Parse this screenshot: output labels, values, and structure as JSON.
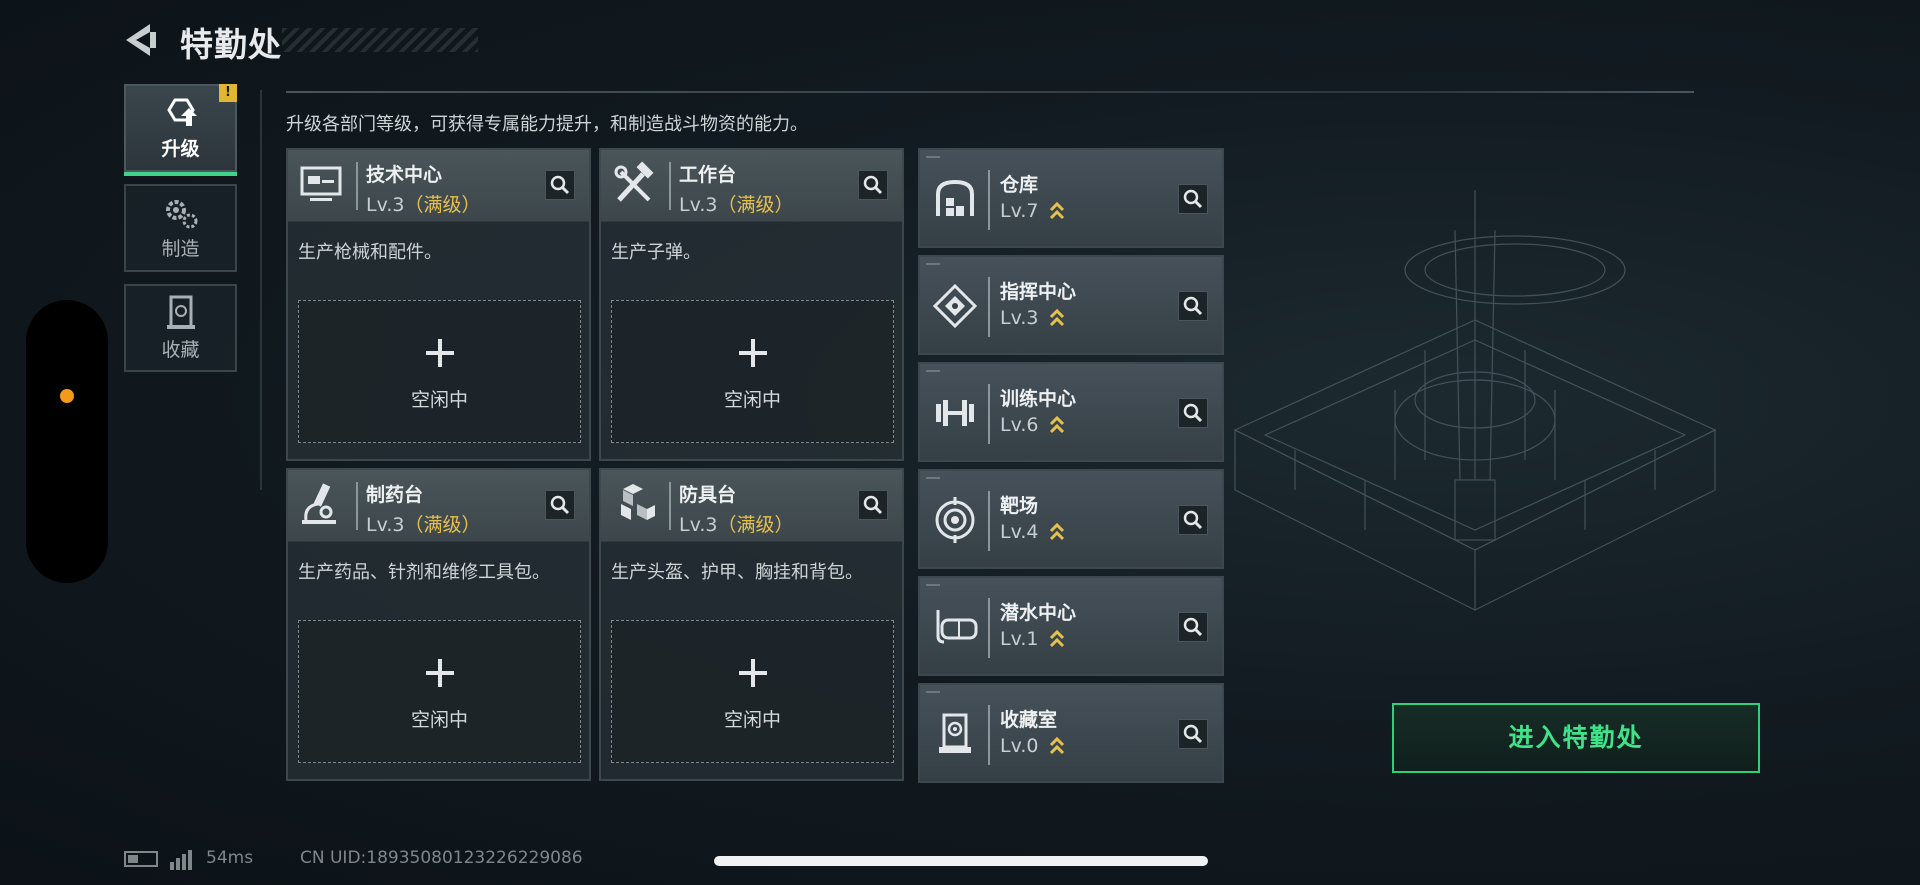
{
  "header": {
    "title": "特勤处"
  },
  "menu": {
    "items": [
      {
        "label": "升级",
        "icon": "upgrade-icon",
        "active": true,
        "alert": "!"
      },
      {
        "label": "制造",
        "icon": "gears-icon",
        "active": false
      },
      {
        "label": "收藏",
        "icon": "collection-icon",
        "active": false
      }
    ]
  },
  "description": "升级各部门等级，可获得专属能力提升，和制造战斗物资的能力。",
  "production_stations": [
    {
      "name": "技术中心",
      "level": "Lv.3",
      "max_tag": "（满级）",
      "desc": "生产枪械和配件。",
      "slot_status": "空闲中",
      "icon": "monitor-icon"
    },
    {
      "name": "工作台",
      "level": "Lv.3",
      "max_tag": "（满级）",
      "desc": "生产子弹。",
      "slot_status": "空闲中",
      "icon": "tools-icon"
    },
    {
      "name": "制药台",
      "level": "Lv.3",
      "max_tag": "（满级）",
      "desc": "生产药品、针剂和维修工具包。",
      "slot_status": "空闲中",
      "icon": "microscope-icon"
    },
    {
      "name": "防具台",
      "level": "Lv.3",
      "max_tag": "（满级）",
      "desc": "生产头盔、护甲、胸挂和背包。",
      "slot_status": "空闲中",
      "icon": "armor-blocks-icon"
    }
  ],
  "departments": [
    {
      "name": "仓库",
      "level": "Lv.7",
      "icon": "warehouse-icon"
    },
    {
      "name": "指挥中心",
      "level": "Lv.3",
      "icon": "command-chip-icon"
    },
    {
      "name": "训练中心",
      "level": "Lv.6",
      "icon": "dumbbell-icon"
    },
    {
      "name": "靶场",
      "level": "Lv.4",
      "icon": "target-icon"
    },
    {
      "name": "潜水中心",
      "level": "Lv.1",
      "icon": "diving-mask-icon"
    },
    {
      "name": "收藏室",
      "level": "Lv.0",
      "icon": "collection-room-icon"
    }
  ],
  "enter_button": "进入特勤处",
  "status_bar": {
    "ping": "54ms",
    "uid": "CN UID:18935080123226229086"
  },
  "colors": {
    "accent_green": "#3ee38a",
    "max_level_gold": "#e6c04f",
    "alert_yellow": "#e2b72f",
    "indicator_orange": "#f39a1a"
  }
}
